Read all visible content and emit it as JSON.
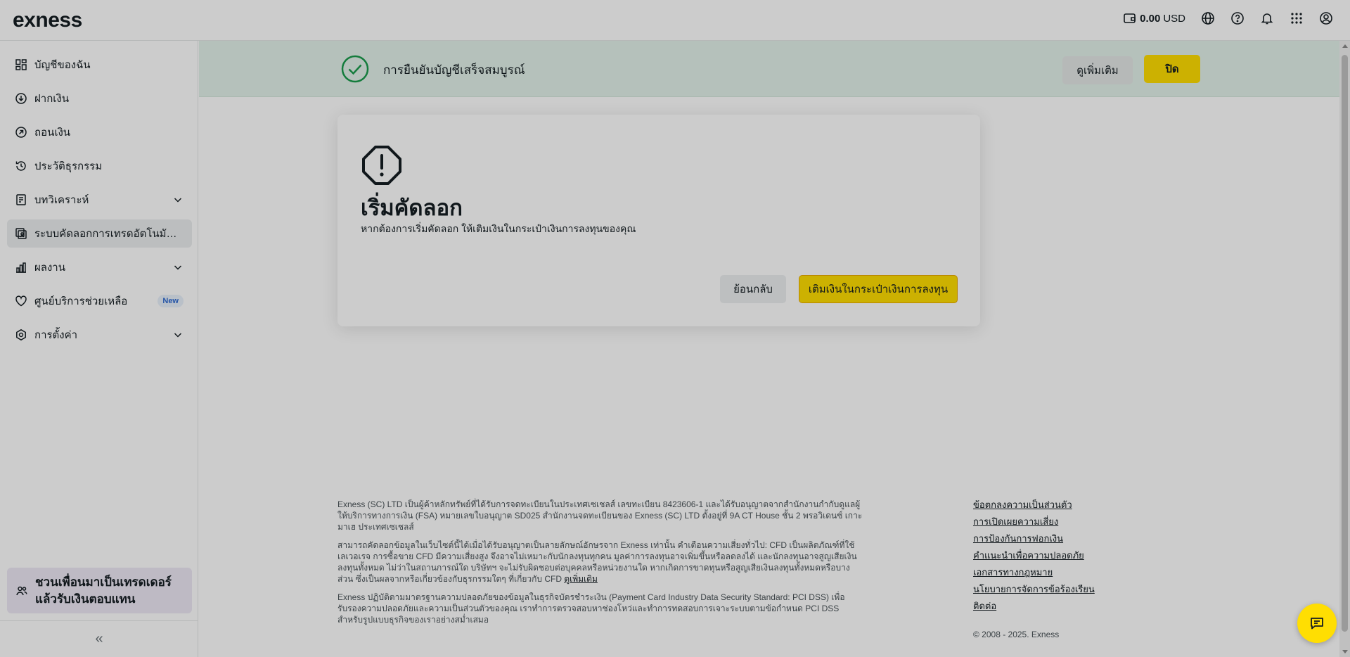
{
  "header": {
    "logo": "exness",
    "balance_amount": "0.00",
    "balance_currency": "USD"
  },
  "sidebar": {
    "items": [
      {
        "label": "บัญชีของฉัน",
        "icon": "grid-icon"
      },
      {
        "label": "ฝากเงิน",
        "icon": "deposit-icon"
      },
      {
        "label": "ถอนเงิน",
        "icon": "withdraw-icon"
      },
      {
        "label": "ประวัติธุรกรรม",
        "icon": "history-icon"
      },
      {
        "label": "บทวิเคราะห์",
        "icon": "analytics-icon"
      },
      {
        "label": "ระบบคัดลอกการเทรดอัตโนมัติ (S...",
        "icon": "copy-trading-icon"
      },
      {
        "label": "ผลงาน",
        "icon": "performance-icon"
      },
      {
        "label": "ศูนย์บริการช่วยเหลือ",
        "icon": "heart-icon",
        "badge": "New"
      },
      {
        "label": "การตั้งค่า",
        "icon": "settings-icon"
      }
    ],
    "referral_line1": "ชวนเพื่อนมาเป็นเทรดเดอร์",
    "referral_line2": "แล้วรับเงินตอบแทน",
    "collapse_glyph": "«"
  },
  "banner": {
    "text": "การยืนยันบัญชีเสร็จสมบูรณ์",
    "more_label": "ดูเพิ่มเติม",
    "close_label": "ปิด"
  },
  "dialog": {
    "title": "เริ่มคัดลอก",
    "description": "หากต้องการเริ่มคัดลอก ให้เติมเงินในกระเป๋าเงินการลงทุนของคุณ",
    "back_label": "ย้อนกลับ",
    "topup_label": "เติมเงินในกระเป๋าเงินการลงทุน"
  },
  "footer": {
    "para1": "Exness (SC) LTD เป็นผู้ค้าหลักทรัพย์ที่ได้รับการจดทะเบียนในประเทศเซเชลส์ เลขทะเบียน 8423606-1 และได้รับอนุญาตจากสำนักงานกำกับดูแลผู้ให้บริการทางการเงิน (FSA) หมายเลขใบอนุญาต SD025 สำนักงานจดทะเบียนของ Exness (SC) LTD ตั้งอยู่ที่ 9A CT House ชั้น 2 พรอวิเดนซ์ เกาะมาเฮ ประเทศเซเชลส์",
    "para2": "สามารถคัดลอกข้อมูลในเว็บไซต์นี้ได้เมื่อได้รับอนุญาตเป็นลายลักษณ์อักษรจาก Exness เท่านั้น คำเตือนความเสี่ยงทั่วไป: CFD เป็นผลิตภัณฑ์ที่ใช้เลเวอเรจ การซื้อขาย CFD มีความเสี่ยงสูง จึงอาจไม่เหมาะกับนักลงทุนทุกคน มูลค่าการลงทุนอาจเพิ่มขึ้นหรือลดลงได้ และนักลงทุนอาจสูญเสียเงินลงทุนทั้งหมด ไม่ว่าในสถานการณ์ใด บริษัทฯ จะไม่รับผิดชอบต่อบุคคลหรือหน่วยงานใด หากเกิดการขาดทุนหรือสูญเสียเงินลงทุนทั้งหมดหรือบางส่วน ซึ่งเป็นผลจากหรือเกี่ยวข้องกับธุรกรรมใดๆ ที่เกี่ยวกับ CFD",
    "para2_link": "ดูเพิ่มเติม",
    "para3": "Exness ปฏิบัติตามมาตรฐานความปลอดภัยของข้อมูลในธุรกิจบัตรชำระเงิน (Payment Card Industry Data Security Standard: PCI DSS) เพื่อรับรองความปลอดภัยและความเป็นส่วนตัวของคุณ เราทำการตรวจสอบหาช่องโหว่และทำการทดสอบการเจาะระบบตามข้อกำหนด PCI DSS สำหรับรูปแบบธุรกิจของเราอย่างสม่ำเสมอ",
    "links": [
      "ข้อตกลงความเป็นส่วนตัว",
      "การเปิดเผยความเสี่ยง",
      "การป้องกันการฟอกเงิน",
      "คำแนะนำเพื่อความปลอดภัย",
      "เอกสารทางกฎหมาย",
      "นโยบายการจัดการข้อร้องเรียน",
      "ติดต่อ"
    ],
    "copyright": "© 2008 - 2025. Exness"
  },
  "colors": {
    "accent_yellow": "#ffde02",
    "success_green": "#1a9b4b",
    "banner_bg": "#e3f2ea"
  }
}
